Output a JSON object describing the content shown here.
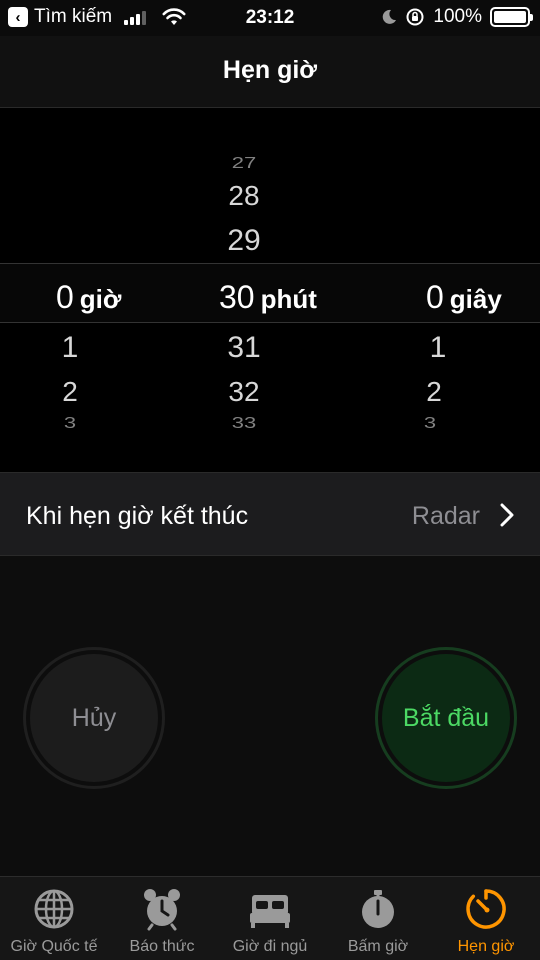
{
  "status_bar": {
    "back_label": "Tìm kiếm",
    "time": "23:12",
    "battery": "100%"
  },
  "nav": {
    "title": "Hẹn giờ"
  },
  "picker": {
    "hours": {
      "above": [],
      "selected": "0",
      "unit": "giờ",
      "below": [
        "1",
        "2",
        "3"
      ]
    },
    "minutes": {
      "above": [
        "27",
        "28",
        "29"
      ],
      "selected": "30",
      "unit": "phút",
      "below": [
        "31",
        "32",
        "33"
      ]
    },
    "seconds": {
      "above": [],
      "selected": "0",
      "unit": "giây",
      "below": [
        "1",
        "2",
        "3"
      ]
    }
  },
  "option": {
    "label": "Khi hẹn giờ kết thúc",
    "value": "Radar"
  },
  "buttons": {
    "cancel": "Hủy",
    "start": "Bắt đầu"
  },
  "tabs": [
    {
      "label": "Giờ Quốc tế",
      "icon": "globe-icon"
    },
    {
      "label": "Báo thức",
      "icon": "alarm-clock-icon"
    },
    {
      "label": "Giờ đi ngủ",
      "icon": "bed-icon"
    },
    {
      "label": "Bấm giờ",
      "icon": "stopwatch-icon"
    },
    {
      "label": "Hẹn giờ",
      "icon": "timer-icon",
      "active": true
    }
  ],
  "colors": {
    "accent": "#ff9500",
    "start_green": "#4cd964",
    "background": "#000000"
  }
}
